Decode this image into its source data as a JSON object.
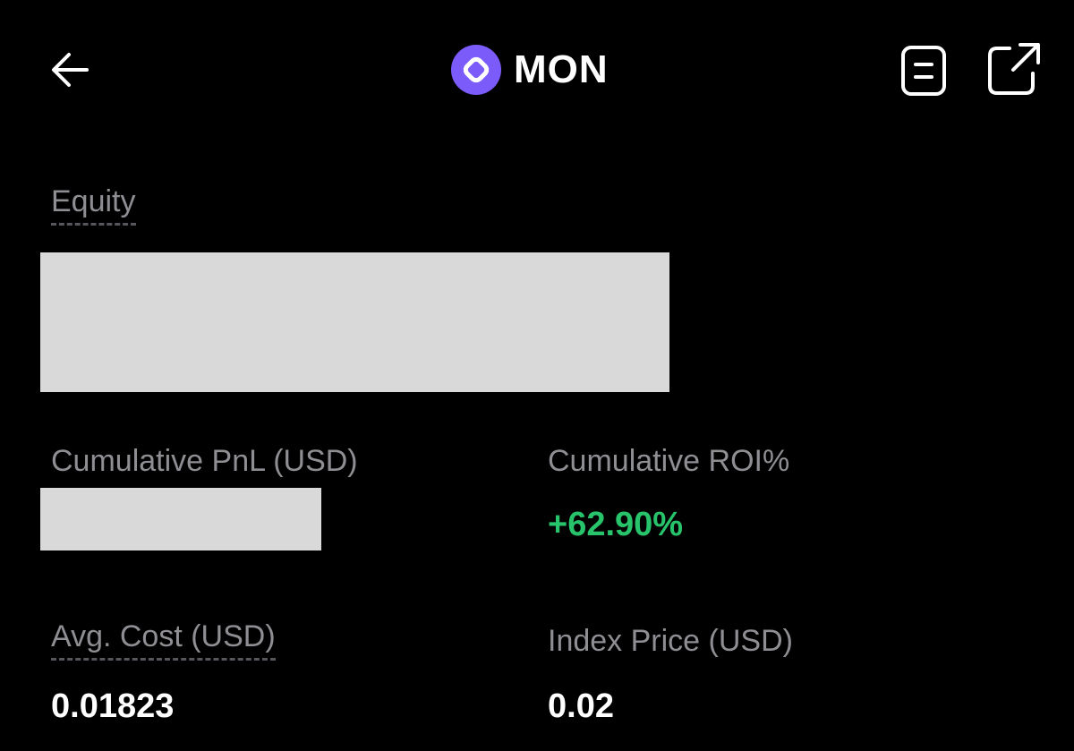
{
  "header": {
    "title": "MON",
    "back_icon": "arrow-left-icon",
    "coin_icon": "mon-coin-icon",
    "doc_icon": "document-icon",
    "share_icon": "external-link-icon",
    "accent_color": "#7B5CFA"
  },
  "equity": {
    "label": "Equity"
  },
  "cumulative_pnl": {
    "label": "Cumulative PnL (USD)"
  },
  "cumulative_roi": {
    "label": "Cumulative ROI%",
    "value": "+62.90%",
    "color": "#27C46B"
  },
  "avg_cost": {
    "label": "Avg. Cost (USD)",
    "value": "0.01823"
  },
  "index_price": {
    "label": "Index Price (USD)",
    "value": "0.02"
  }
}
